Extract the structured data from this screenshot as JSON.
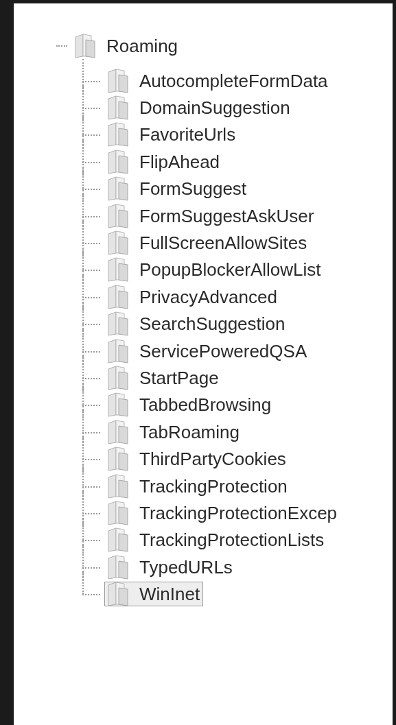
{
  "tree": {
    "label": "Roaming",
    "selected": false,
    "children": [
      {
        "label": "AutocompleteFormData",
        "selected": false
      },
      {
        "label": "DomainSuggestion",
        "selected": false
      },
      {
        "label": "FavoriteUrls",
        "selected": false
      },
      {
        "label": "FlipAhead",
        "selected": false
      },
      {
        "label": "FormSuggest",
        "selected": false
      },
      {
        "label": "FormSuggestAskUser",
        "selected": false
      },
      {
        "label": "FullScreenAllowSites",
        "selected": false
      },
      {
        "label": "PopupBlockerAllowList",
        "selected": false
      },
      {
        "label": "PrivacyAdvanced",
        "selected": false
      },
      {
        "label": "SearchSuggestion",
        "selected": false
      },
      {
        "label": "ServicePoweredQSA",
        "selected": false
      },
      {
        "label": "StartPage",
        "selected": false
      },
      {
        "label": "TabbedBrowsing",
        "selected": false
      },
      {
        "label": "TabRoaming",
        "selected": false
      },
      {
        "label": "ThirdPartyCookies",
        "selected": false
      },
      {
        "label": "TrackingProtection",
        "selected": false
      },
      {
        "label": "TrackingProtectionExcep",
        "selected": false
      },
      {
        "label": "TrackingProtectionLists",
        "selected": false
      },
      {
        "label": "TypedURLs",
        "selected": false
      },
      {
        "label": "WinInet",
        "selected": true
      }
    ]
  }
}
